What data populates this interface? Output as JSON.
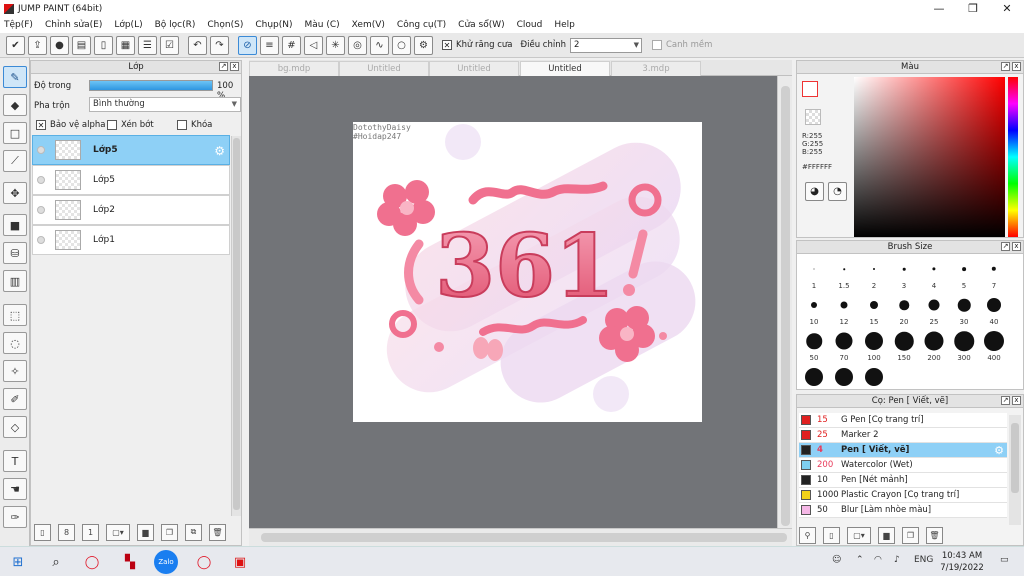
{
  "window": {
    "title": "JUMP PAINT (64bit)",
    "controls": {
      "minimize": "—",
      "maximize": "❐",
      "close": "✕"
    }
  },
  "menu": {
    "items": [
      "Tệp(F)",
      "Chỉnh sửa(E)",
      "Lớp(L)",
      "Bộ lọc(R)",
      "Chọn(S)",
      "Chụp(N)",
      "Màu (C)",
      "Xem(V)",
      "Công cụ(T)",
      "Cửa sổ(W)",
      "Cloud",
      "Help"
    ]
  },
  "toolbar": {
    "antialias_label": "Khử răng cưa",
    "adjust_label": "Điều chỉnh",
    "adjust_value": "2",
    "snap_label": "Canh mềm"
  },
  "layer_panel": {
    "title": "Lớp",
    "opacity_label": "Độ trong",
    "opacity_value": "100 %",
    "blend_label": "Pha trộn",
    "blend_value": "Bình thường",
    "protect_alpha": "Bảo vệ alpha",
    "clip": "Xén bớt",
    "lock": "Khóa",
    "layers": [
      {
        "name": "Lớp5",
        "selected": true
      },
      {
        "name": "Lớp5",
        "selected": false
      },
      {
        "name": "Lớp2",
        "selected": false
      },
      {
        "name": "Lớp1",
        "selected": false
      }
    ]
  },
  "tabs": [
    "bg.mdp",
    "Untitled",
    "Untitled",
    "Untitled",
    "3.mdp"
  ],
  "active_tab_index": 3,
  "artwork": {
    "credit_line1": "DotothyDaisy",
    "credit_line2": "#Hoidap247",
    "text": "361"
  },
  "color_panel": {
    "title": "Màu",
    "r": "R:255",
    "g": "G:255",
    "b": "B:255",
    "hex": "#FFFFFF"
  },
  "brush_panel": {
    "title": "Brush Size",
    "sizes": [
      "1",
      "1.5",
      "2",
      "3",
      "4",
      "5",
      "7",
      "10",
      "12",
      "15",
      "20",
      "25",
      "30",
      "40",
      "50",
      "70",
      "100",
      "150",
      "200",
      "300",
      "400",
      "",
      "",
      ""
    ]
  },
  "pen_panel": {
    "title": "Cọ: Pen [ Viết, vẽ]",
    "pens": [
      {
        "size": "15",
        "name": "G Pen [Cọ trang trí]",
        "color": "#e02020",
        "selected": false
      },
      {
        "size": "25",
        "name": "Marker 2",
        "color": "#e02020",
        "selected": false
      },
      {
        "size": "4",
        "name": "Pen [ Viết, vẽ]",
        "color": "#222222",
        "selected": true
      },
      {
        "size": "200",
        "name": "Watercolor (Wet)",
        "color": "#7ecff0",
        "selected": false
      },
      {
        "size": "10",
        "name": "Pen [Nét mảnh]",
        "color": "#222222",
        "selected": false
      },
      {
        "size": "1000",
        "name": "Plastic Crayon [Cọ trang trí]",
        "color": "#f2d21a",
        "selected": false
      },
      {
        "size": "50",
        "name": "Blur [Làm nhòe màu]",
        "color": "#f5b7e6",
        "selected": false
      }
    ]
  },
  "taskbar": {
    "language": "ENG",
    "time": "10:43 AM",
    "date": "7/19/2022"
  }
}
